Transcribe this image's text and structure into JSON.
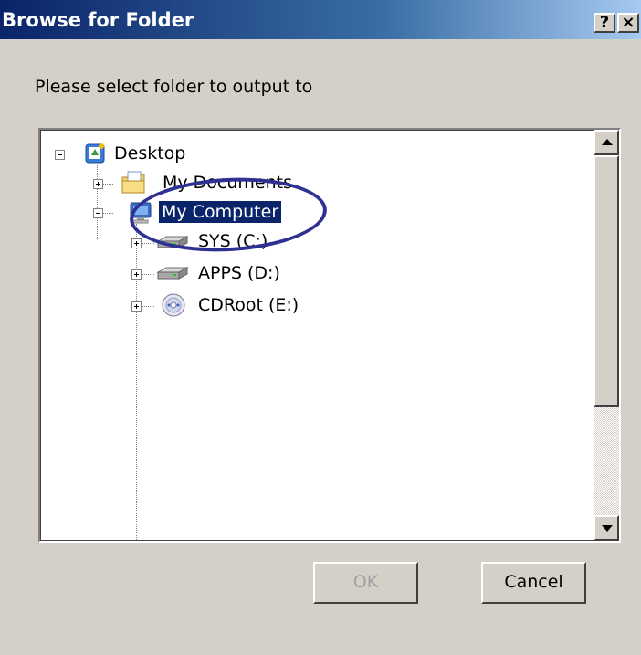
{
  "window": {
    "title": "Browse for Folder",
    "help_button": "?",
    "close_button": "×"
  },
  "prompt": "Please select folder to output to",
  "tree": {
    "items": [
      {
        "label": "Desktop",
        "icon": "desktop-icon",
        "expander": "minus"
      },
      {
        "label": "My Documents",
        "icon": "my-documents-icon",
        "expander": "plus"
      },
      {
        "label": "My Computer",
        "icon": "my-computer-icon",
        "expander": "minus",
        "selected": true
      },
      {
        "label": "SYS (C:)",
        "icon": "hard-drive-icon",
        "expander": "plus"
      },
      {
        "label": "APPS (D:)",
        "icon": "hard-drive-icon",
        "expander": "plus"
      },
      {
        "label": "CDRoot (E:)",
        "icon": "cd-drive-icon",
        "expander": "plus"
      }
    ]
  },
  "buttons": {
    "ok": "OK",
    "cancel": "Cancel"
  },
  "colors": {
    "selection": "#0a246a",
    "annotation_ring": "#2f3192",
    "dialog_bg": "#d4d0c8"
  }
}
